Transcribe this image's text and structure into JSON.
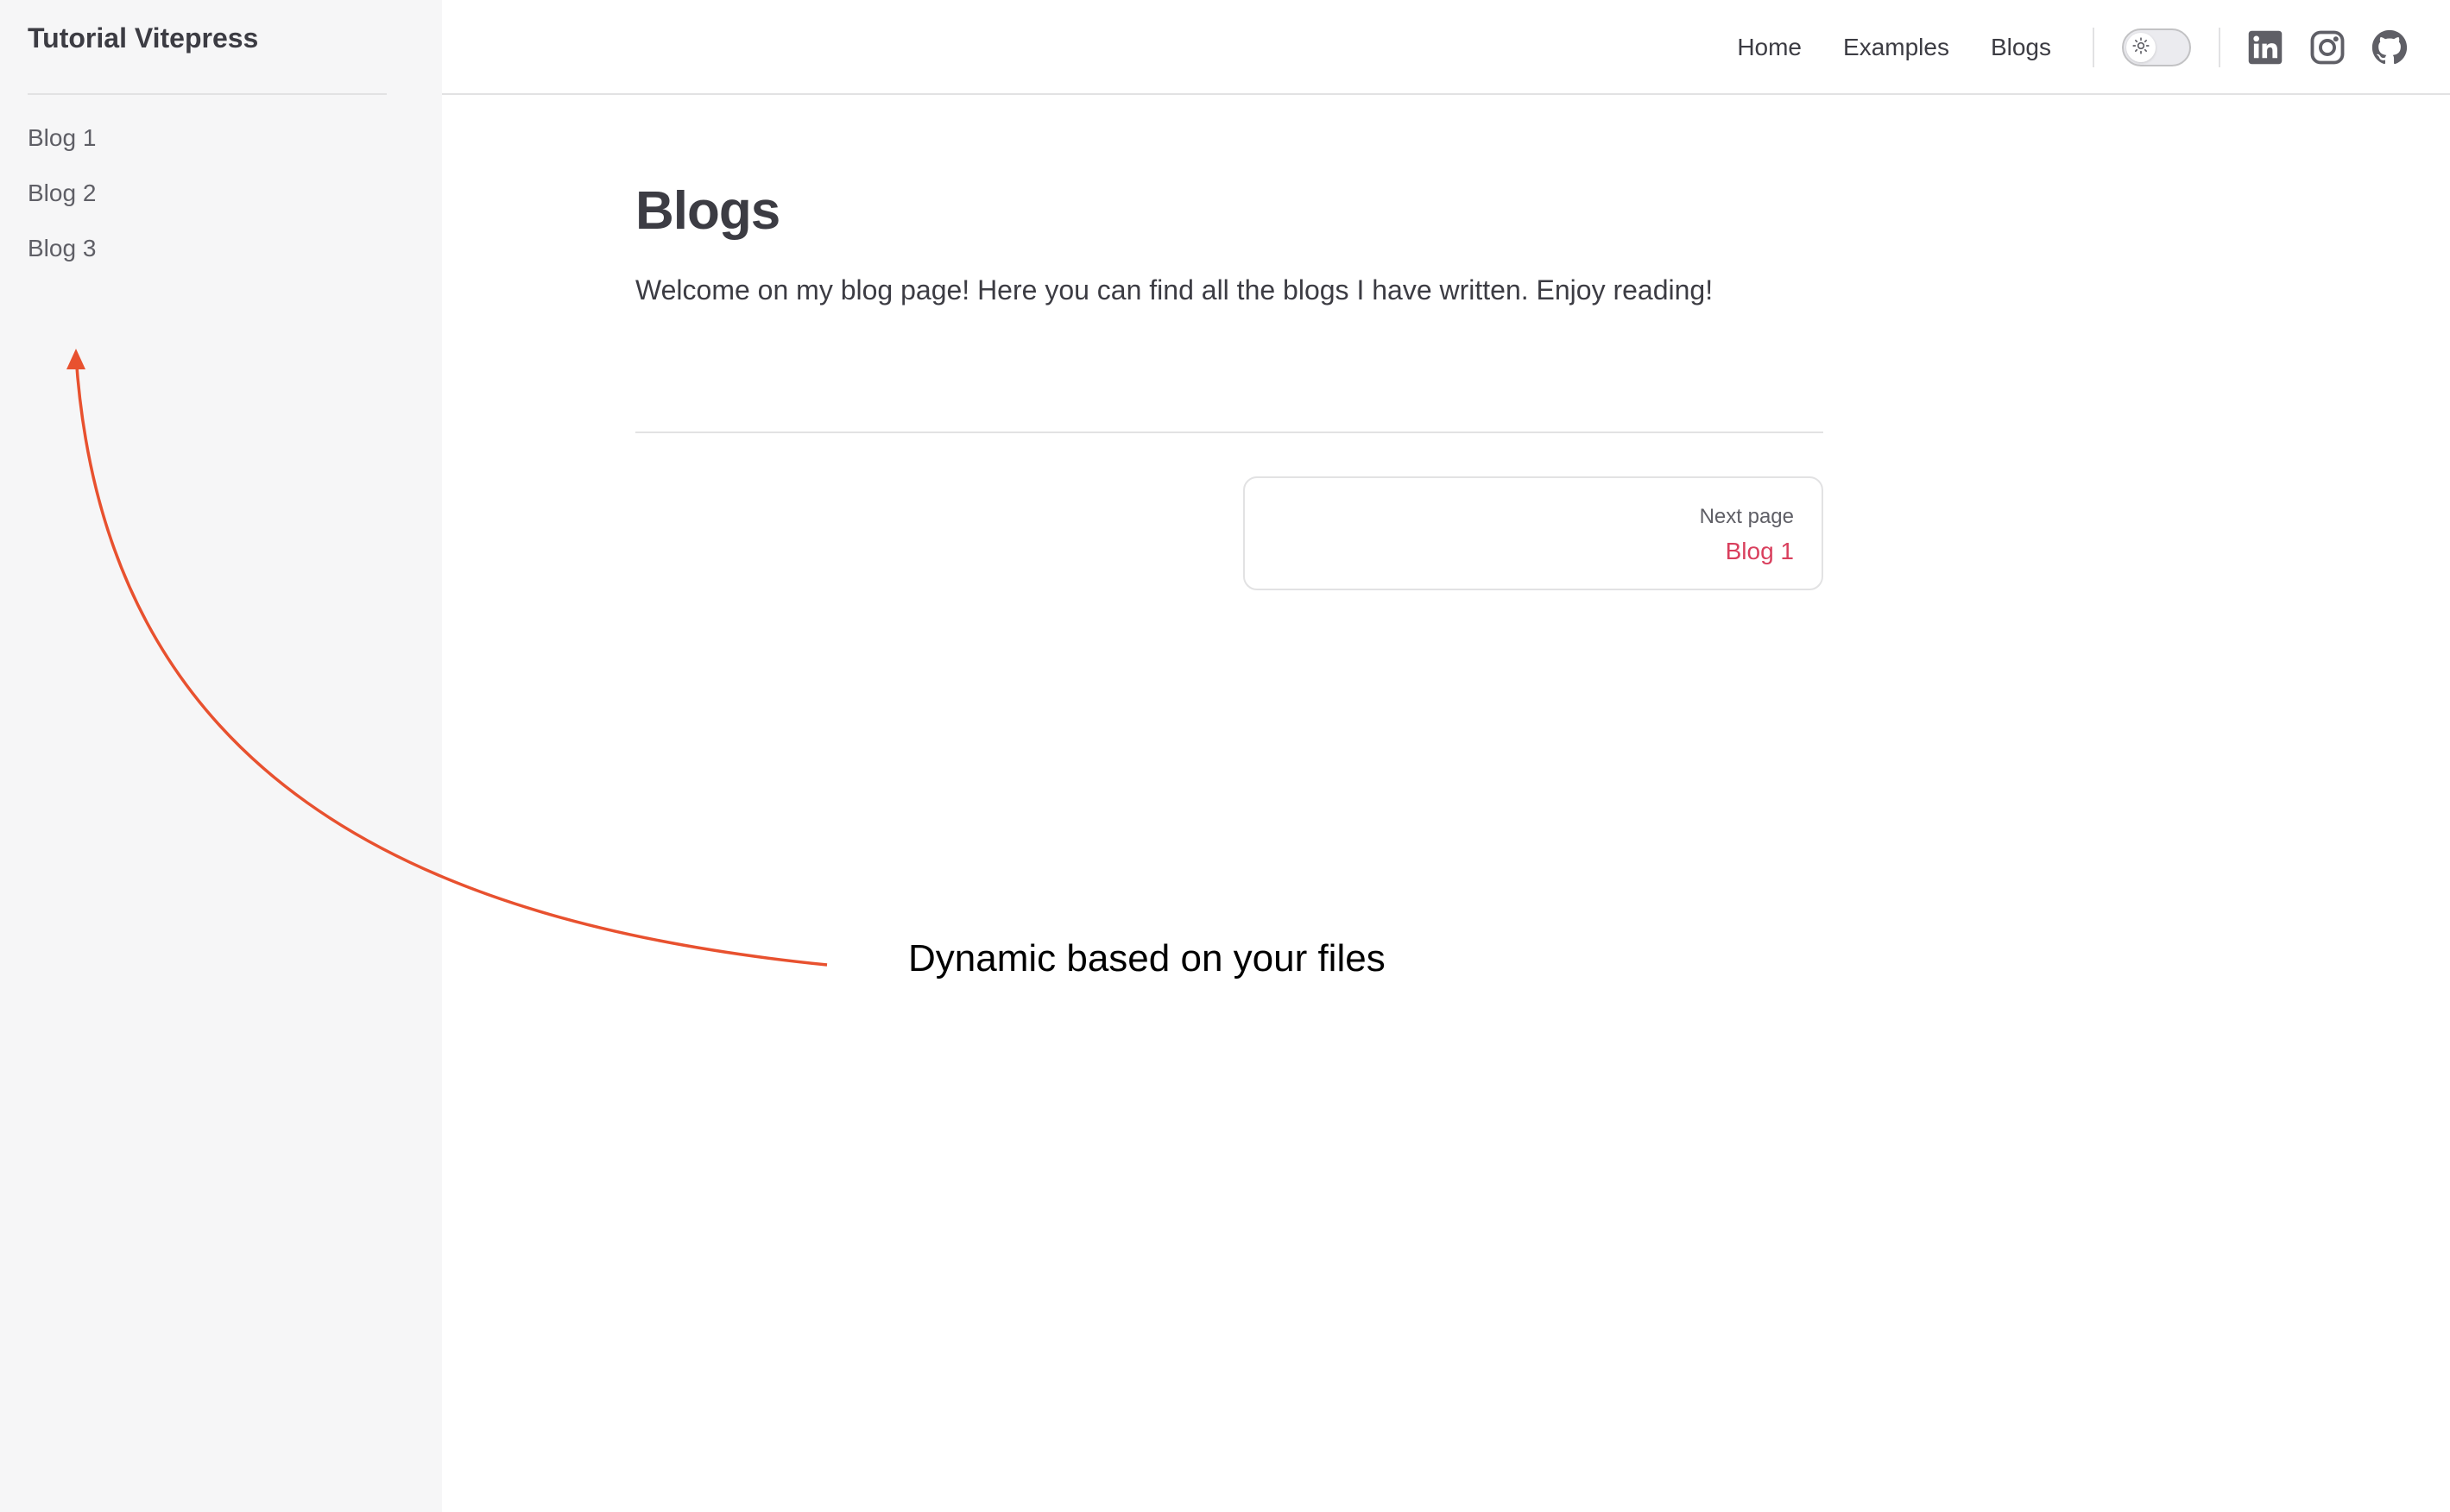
{
  "sidebar": {
    "site_title": "Tutorial Vitepress",
    "items": [
      {
        "label": "Blog 1"
      },
      {
        "label": "Blog 2"
      },
      {
        "label": "Blog 3"
      }
    ]
  },
  "topnav": {
    "links": [
      {
        "label": "Home"
      },
      {
        "label": "Examples"
      },
      {
        "label": "Blogs"
      }
    ],
    "theme_toggle_icon": "sun-icon",
    "social": [
      {
        "icon": "linkedin-icon"
      },
      {
        "icon": "instagram-icon"
      },
      {
        "icon": "github-icon"
      }
    ]
  },
  "main": {
    "title": "Blogs",
    "intro": "Welcome on my blog page! Here you can find all the blogs I have written. Enjoy reading!",
    "next": {
      "desc": "Next page",
      "title": "Blog 1"
    }
  },
  "annotation": {
    "text": "Dynamic based on your files",
    "color": "#e8512f"
  },
  "colors": {
    "brand": "#d93f5d",
    "sidebar_bg": "#f6f6f7",
    "text": "#3c3c43"
  }
}
